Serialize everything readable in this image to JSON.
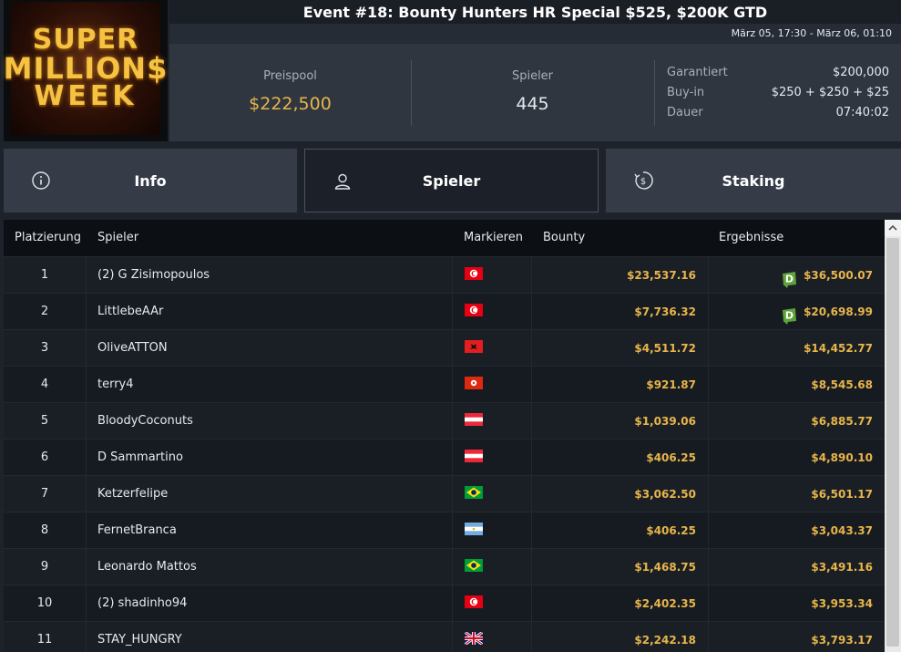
{
  "header": {
    "logo_text": "SUPER MILLION$ WEEK",
    "title": "Event #18: Bounty Hunters HR Special $525, $200K GTD",
    "date_range": "März 05, 17:30 - März 06, 01:10"
  },
  "stats": {
    "prizepool_label": "Preispool",
    "prizepool_value": "$222,500",
    "players_label": "Spieler",
    "players_value": "445",
    "guaranteed_label": "Garantiert",
    "guaranteed_value": "$200,000",
    "buyin_label": "Buy-in",
    "buyin_value": "$250 + $250 + $25",
    "duration_label": "Dauer",
    "duration_value": "07:40:02"
  },
  "tabs": [
    {
      "label": "Info",
      "icon": "info-icon",
      "active": false
    },
    {
      "label": "Spieler",
      "icon": "user-icon",
      "active": true
    },
    {
      "label": "Staking",
      "icon": "dollar-coin-icon",
      "active": false
    }
  ],
  "table": {
    "columns": [
      "Platzierung",
      "Spieler",
      "Markieren",
      "Bounty",
      "Ergebnisse"
    ],
    "rows": [
      {
        "place": "1",
        "player": "(2) G Zisimopoulos",
        "flag": "tunisia",
        "bounty": "$23,537.16",
        "result": "$36,500.07",
        "deal": true
      },
      {
        "place": "2",
        "player": "LittlebeAAr",
        "flag": "tunisia",
        "bounty": "$7,736.32",
        "result": "$20,698.99",
        "deal": true
      },
      {
        "place": "3",
        "player": "OliveATTON",
        "flag": "albania",
        "bounty": "$4,511.72",
        "result": "$14,452.77",
        "deal": false
      },
      {
        "place": "4",
        "player": "terry4",
        "flag": "hong-kong",
        "bounty": "$921.87",
        "result": "$8,545.68",
        "deal": false
      },
      {
        "place": "5",
        "player": "BloodyCoconuts",
        "flag": "austria",
        "bounty": "$1,039.06",
        "result": "$6,885.77",
        "deal": false
      },
      {
        "place": "6",
        "player": "D Sammartino",
        "flag": "austria",
        "bounty": "$406.25",
        "result": "$4,890.10",
        "deal": false
      },
      {
        "place": "7",
        "player": "Ketzerfelipe",
        "flag": "brazil",
        "bounty": "$3,062.50",
        "result": "$6,501.17",
        "deal": false
      },
      {
        "place": "8",
        "player": "FernetBranca",
        "flag": "argentina",
        "bounty": "$406.25",
        "result": "$3,043.37",
        "deal": false
      },
      {
        "place": "9",
        "player": "Leonardo Mattos",
        "flag": "brazil",
        "bounty": "$1,468.75",
        "result": "$3,491.16",
        "deal": false
      },
      {
        "place": "10",
        "player": "(2) shadinho94",
        "flag": "tunisia",
        "bounty": "$2,402.35",
        "result": "$3,953.34",
        "deal": false
      },
      {
        "place": "11",
        "player": "STAY_HUNGRY",
        "flag": "united-kingdom",
        "bounty": "$2,242.18",
        "result": "$3,793.17",
        "deal": false
      }
    ],
    "deal_badge_letter": "D"
  },
  "colors": {
    "gold": "#e8b54a",
    "deal_green": "#5ea33a"
  }
}
